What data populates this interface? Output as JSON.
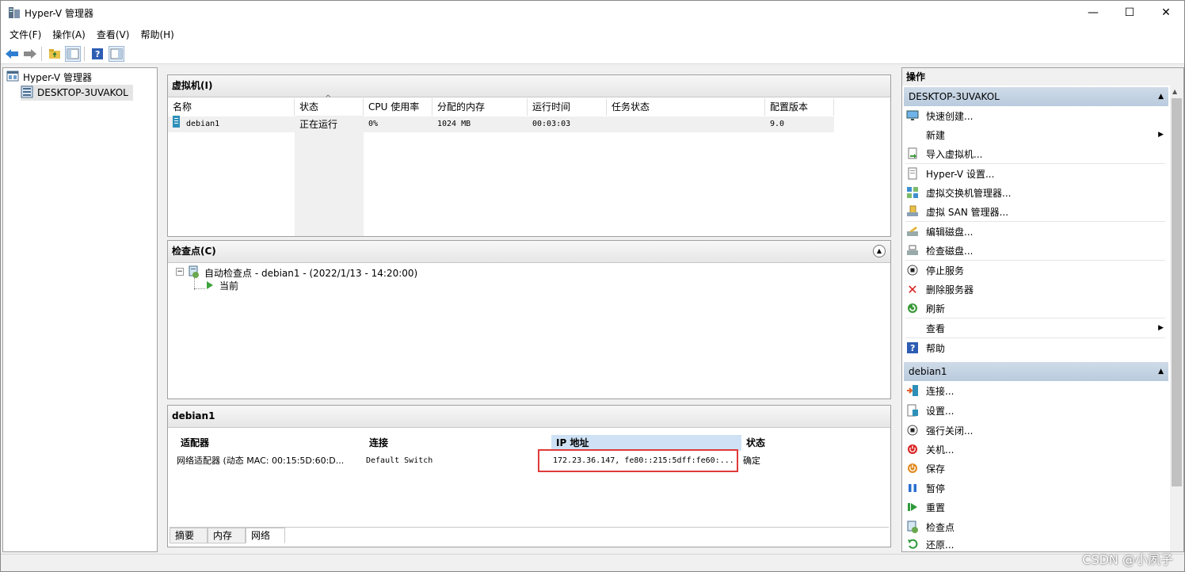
{
  "window": {
    "title": "Hyper-V 管理器",
    "controls": {
      "minimize": "—",
      "maximize": "☐",
      "close": "✕"
    }
  },
  "menu": [
    "文件(F)",
    "操作(A)",
    "查看(V)",
    "帮助(H)"
  ],
  "toolbar": {
    "icons": [
      "back-arrow-icon",
      "forward-arrow-icon",
      "folder-up-icon",
      "show-tree-icon",
      "help-icon",
      "show-actions-icon"
    ]
  },
  "tree": {
    "root": "Hyper-V 管理器",
    "host": "DESKTOP-3UVAKOL"
  },
  "vms": {
    "header": "虚拟机(I)",
    "columns": [
      "名称",
      "状态",
      "CPU 使用率",
      "分配的内存",
      "运行时间",
      "任务状态",
      "配置版本"
    ],
    "rows": [
      {
        "name": "debian1",
        "state": "正在运行",
        "cpu": "0%",
        "memory": "1024 MB",
        "uptime": "00:03:03",
        "task": "",
        "version": "9.0"
      }
    ]
  },
  "checkpoints": {
    "header": "检查点(C)",
    "item": "自动检查点 - debian1 - (2022/1/13 - 14:20:00)",
    "current": "当前"
  },
  "details": {
    "header": "debian1",
    "columns": [
      "适配器",
      "连接",
      "IP 地址",
      "状态"
    ],
    "row": {
      "adapter": "网络适配器 (动态 MAC: 00:15:5D:60:D...",
      "connection": "Default Switch",
      "ip": "172.23.36.147,  fe80::215:5dff:fe60:...",
      "status": "确定"
    },
    "tabs": [
      "摘要",
      "内存",
      "网络"
    ],
    "active_tab": "网络",
    "highlight_color": "#e03a3a"
  },
  "actions": {
    "title": "操作",
    "host_group": "DESKTOP-3UVAKOL",
    "host_items": [
      "快速创建...",
      "新建",
      "导入虚拟机...",
      "Hyper-V 设置...",
      "虚拟交换机管理器...",
      "虚拟 SAN 管理器...",
      "编辑磁盘...",
      "检查磁盘...",
      "停止服务",
      "删除服务器",
      "刷新",
      "查看",
      "帮助"
    ],
    "vm_group": "debian1",
    "vm_items": [
      "连接...",
      "设置...",
      "强行关闭...",
      "关机...",
      "保存",
      "暂停",
      "重置",
      "检查点",
      "还原..."
    ]
  },
  "watermark": "CSDN @小夙子"
}
